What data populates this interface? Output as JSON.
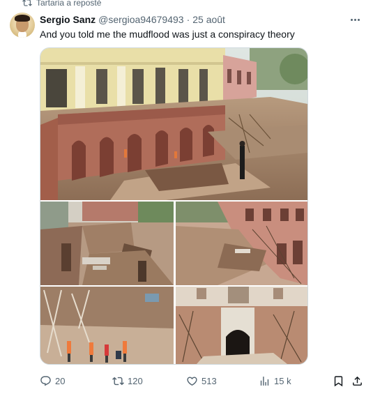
{
  "repost": {
    "text": "Tartaria a reposté",
    "icon": "repost-icon"
  },
  "author": {
    "name": "Sergio Sanz",
    "handle": "@sergioa94679493",
    "separator": "·",
    "date": "25 août",
    "avatar": "avatar"
  },
  "tweet": {
    "text": "And you told me the mudflood was just a conspiracy theory"
  },
  "media": {
    "photos": [
      "photo-excavated-palace",
      "photo-excavated-courtyard",
      "photo-ruined-building-dig",
      "photo-workers-at-dig",
      "photo-buried-archway"
    ]
  },
  "actions": {
    "reply": "20",
    "repost": "120",
    "like": "513",
    "views": "15 k"
  },
  "colors": {
    "text": "#0f1419",
    "secondary": "#536471",
    "border": "#cfd9de"
  }
}
